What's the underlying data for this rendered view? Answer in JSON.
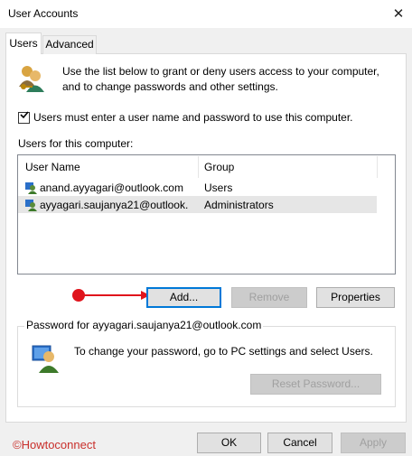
{
  "window": {
    "title": "User Accounts",
    "close_glyph": "✕"
  },
  "tabs": [
    {
      "label": "Users",
      "active": true
    },
    {
      "label": "Advanced",
      "active": false
    }
  ],
  "info_text": [
    "Use the list below to grant or deny users access to your computer,",
    "and to change passwords and other settings."
  ],
  "require_login": {
    "label": "Users must enter a user name and password to use this computer.",
    "checked": true
  },
  "users_label": "Users for this computer:",
  "users_table": {
    "columns": [
      "User Name",
      "Group"
    ],
    "rows": [
      {
        "user": "anand.ayyagari@outlook.com",
        "group": "Users",
        "selected": false
      },
      {
        "user": "ayyagari.saujanya21@outlook.",
        "group": "Administrators",
        "selected": true
      }
    ]
  },
  "buttons": {
    "add": "Add...",
    "remove": "Remove",
    "properties": "Properties"
  },
  "password_group": {
    "label": "Password for ayyagari.saujanya21@outlook.com",
    "text": "To change your password, go to PC settings and select Users.",
    "reset": "Reset Password..."
  },
  "footer": {
    "ok": "OK",
    "cancel": "Cancel",
    "apply": "Apply"
  },
  "watermark": "©Howtoconnect",
  "colors": {
    "annotation": "#e0141c",
    "selection": "#e6e6e6",
    "accent": "#0078d7"
  }
}
